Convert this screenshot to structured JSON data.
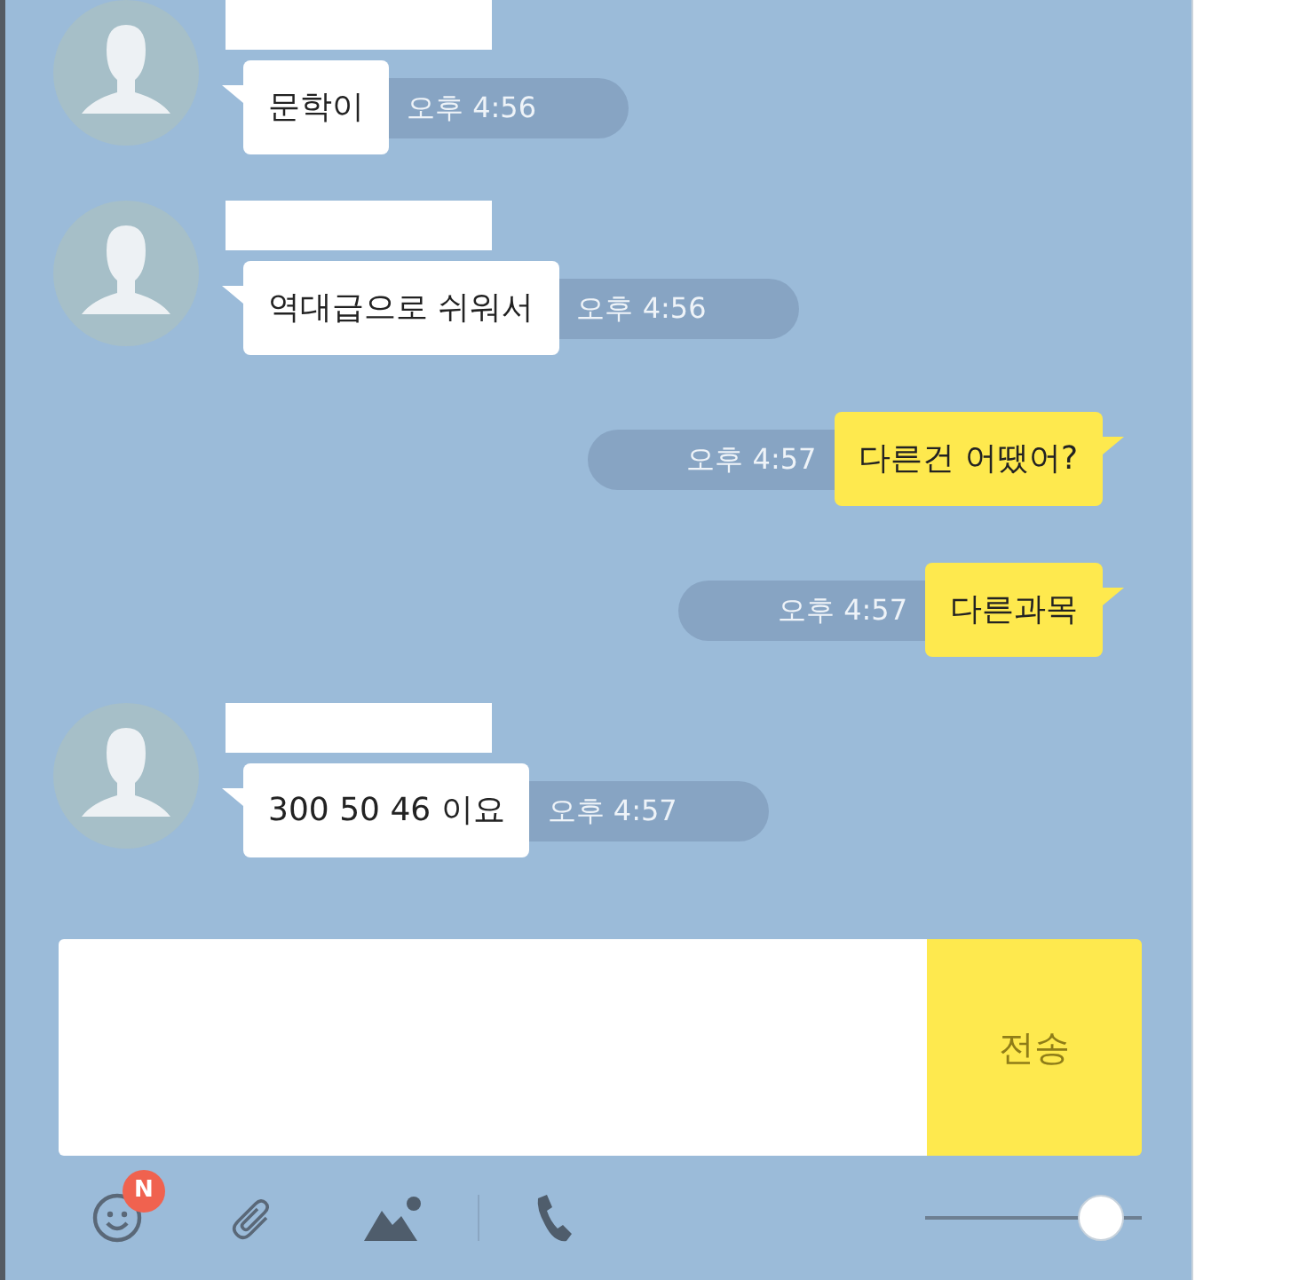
{
  "messages": [
    {
      "kind": "incoming",
      "text": "문학이",
      "time": "오후 4:56"
    },
    {
      "kind": "incoming",
      "text": "역대급으로 쉬워서",
      "time": "오후 4:56"
    },
    {
      "kind": "outgoing",
      "text": "다른건 어땠어?",
      "time": "오후 4:57"
    },
    {
      "kind": "outgoing",
      "text": "다른과목",
      "time": "오후 4:57"
    },
    {
      "kind": "incoming",
      "text": "300 50 46 이요",
      "time": "오후 4:57"
    }
  ],
  "composer": {
    "send_label": "전송"
  },
  "toolbar": {
    "emoji_badge": "N",
    "zoom_slider": {
      "level": 0.9
    }
  }
}
